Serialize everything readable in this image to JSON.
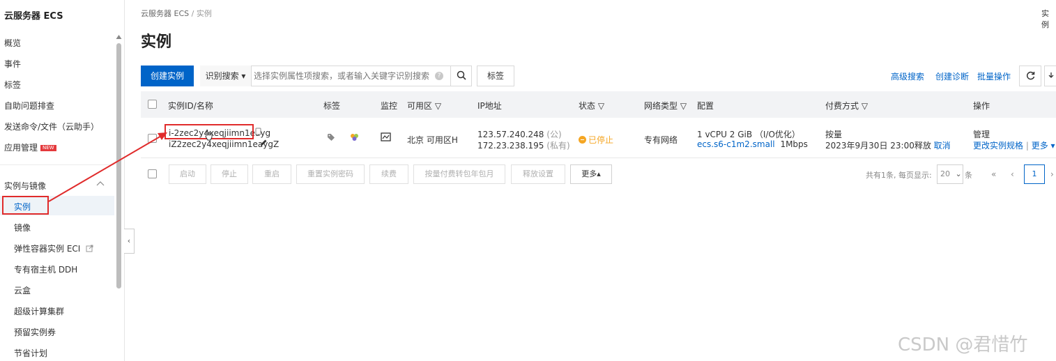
{
  "sidebar": {
    "title": "云服务器 ECS",
    "items": [
      {
        "label": "概览"
      },
      {
        "label": "事件"
      },
      {
        "label": "标签"
      },
      {
        "label": "自助问题排查"
      },
      {
        "label": "发送命令/文件（云助手）"
      },
      {
        "label": "应用管理",
        "badge": "NEW"
      }
    ],
    "group": {
      "label": "实例与镜像",
      "chevron": "^"
    },
    "subitems": [
      {
        "label": "实例"
      },
      {
        "label": "镜像"
      },
      {
        "label": "弹性容器实例 ECI"
      },
      {
        "label": "专有宿主机 DDH"
      },
      {
        "label": "云盒"
      },
      {
        "label": "超级计算集群"
      },
      {
        "label": "预留实例券"
      },
      {
        "label": "节省计划"
      }
    ],
    "collapse_glyph": "‹"
  },
  "breadcrumb": {
    "root": "云服务器 ECS",
    "sep": "/",
    "current": "实例"
  },
  "page_title": "实例",
  "top_right": "实例",
  "toolbar": {
    "create_label": "创建实例",
    "search_mode_label": "识别搜索 ▾",
    "search_placeholder": "选择实例属性项搜索，或者输入关键字识别搜索",
    "help_glyph": "?",
    "tag_label": "标签",
    "advanced_search": "高级搜索",
    "create_diagnosis": "创建诊断",
    "batch_ops": "批量操作"
  },
  "table": {
    "headers": {
      "id_name": "实例ID/名称",
      "tag": "标签",
      "monitor": "监控",
      "zone": "可用区 ▽",
      "ip": "IP地址",
      "status": "状态 ▽",
      "network": "网络类型 ▽",
      "config": "配置",
      "billing": "付费方式 ▽",
      "ops": "操作"
    },
    "row": {
      "instance_id": "i-2zec2y4xeqjiimn1eayg",
      "instance_name": "iZ2zec2y4xeqjiimn1eaygZ",
      "zone": "北京 可用区H",
      "public_ip": "123.57.240.248",
      "public_tag": "(公)",
      "private_ip": "172.23.238.195",
      "private_tag": "(私有)",
      "status": "已停止",
      "network": "专有网络",
      "config_line1": "1 vCPU 2 GiB （I/O优化）",
      "config_type": "ecs.s6-c1m2.small",
      "config_bw": "1Mbps",
      "billing_type": "按量",
      "release_time": "2023年9月30日 23:00释放",
      "release_cancel": "取消",
      "op_manage": "管理",
      "op_change_spec": "更改实例规格",
      "op_sep": "|",
      "op_more": "更多 ▾"
    }
  },
  "bulk_actions": [
    "启动",
    "停止",
    "重启",
    "重置实例密码",
    "续费",
    "按量付费转包年包月",
    "释放设置"
  ],
  "bulk_more": "更多▴",
  "pagination": {
    "summary": "共有1条, 每页显示:",
    "page_size": "20",
    "page_size_arrow": "⌄",
    "unit": "条",
    "first": "«",
    "prev": "‹",
    "current": "1",
    "next": "›"
  },
  "watermark": "CSDN @君惜竹",
  "colors": {
    "primary": "#0064c8",
    "annotation_red": "#e02b2b",
    "stopped": "#f5a623",
    "new_badge": "#e4393c"
  }
}
